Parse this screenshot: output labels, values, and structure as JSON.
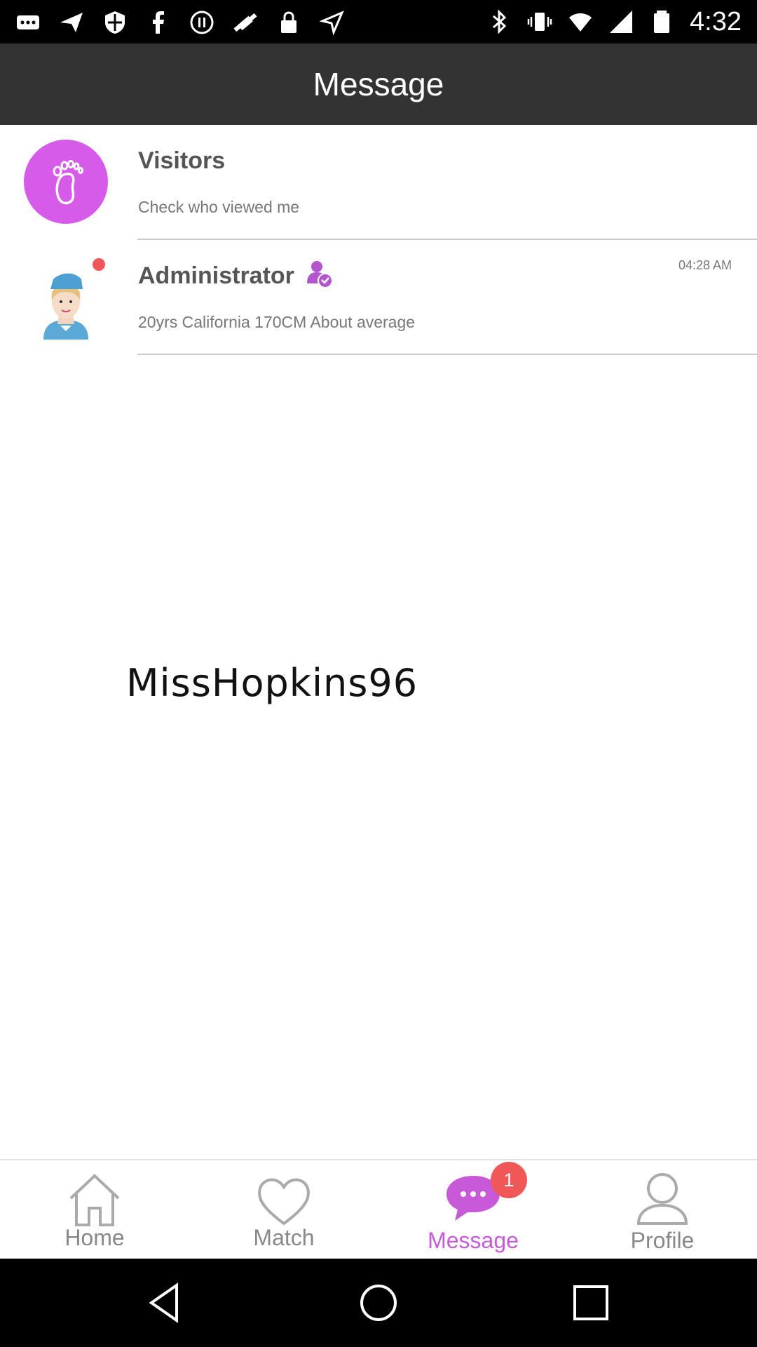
{
  "status_bar": {
    "time": "4:32",
    "left_icons": [
      "more-icon",
      "send-icon",
      "shield-icon",
      "facebook-icon",
      "record-icon",
      "fake-gps-icon",
      "lock-icon",
      "location-arrow-icon"
    ],
    "right_icons": [
      "bluetooth-icon",
      "vibrate-icon",
      "wifi-icon",
      "signal-icon",
      "battery-icon"
    ]
  },
  "header": {
    "title": "Message"
  },
  "conversations": [
    {
      "title": "Visitors",
      "subtitle": "Check who viewed me",
      "icon": "footprint-icon",
      "avatar_color": "#d65be9"
    },
    {
      "title": "Administrator",
      "subtitle": "20yrs California 170CM About average",
      "time": "04:28 AM",
      "unread": true,
      "verified_icon": "verified-user-icon"
    }
  ],
  "watermark": "MissHopkins96",
  "tabs": [
    {
      "label": "Home",
      "icon": "home-icon",
      "active": false
    },
    {
      "label": "Match",
      "icon": "heart-icon",
      "active": false
    },
    {
      "label": "Message",
      "icon": "chat-icon",
      "active": true,
      "badge": "1"
    },
    {
      "label": "Profile",
      "icon": "person-icon",
      "active": false
    }
  ],
  "colors": {
    "accent": "#c85ad9",
    "badge": "#f05858",
    "header": "#333333"
  },
  "nav_bar": [
    "back-icon",
    "home-circle-icon",
    "recents-icon"
  ]
}
